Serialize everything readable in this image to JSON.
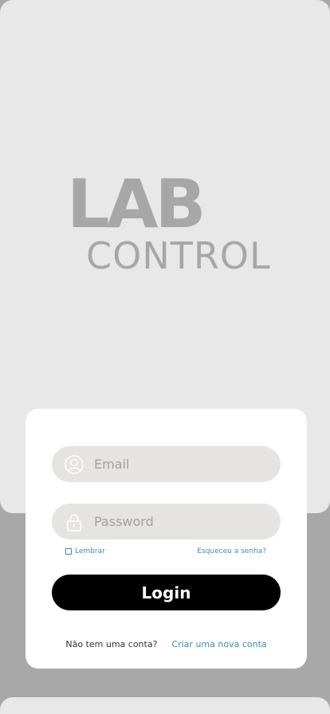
{
  "logo": {
    "line1": "LAB",
    "line2": "CONTROL"
  },
  "form": {
    "email_placeholder": "Email",
    "password_placeholder": "Password",
    "remember_label": "Lembrar",
    "forgot_label": "Esqueceu a senha?",
    "login_label": "Login",
    "no_account_text": "Não tem uma conta?",
    "create_account_label": "Criar uma nova conta"
  },
  "icons": {
    "email": "user-circle-icon",
    "password": "lock-icon",
    "remember": "checkbox-icon"
  },
  "colors": {
    "accent": "#3d8bbf",
    "button": "#000000",
    "field": "#e6e3e3",
    "logo": "#a7a7a7"
  }
}
